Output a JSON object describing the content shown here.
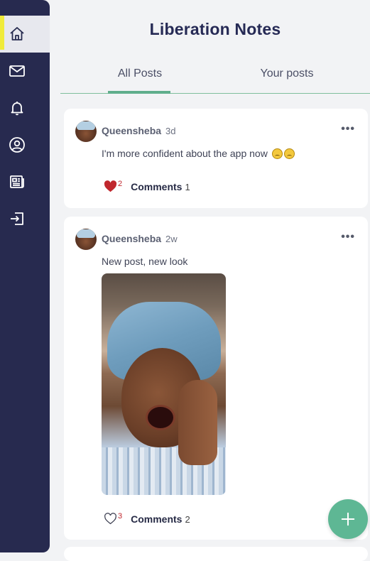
{
  "app": {
    "title": "Liberation Notes"
  },
  "sidebar": {
    "items": [
      {
        "icon": "home-icon",
        "active": true
      },
      {
        "icon": "mail-icon"
      },
      {
        "icon": "bell-icon"
      },
      {
        "icon": "profile-icon"
      },
      {
        "icon": "news-icon"
      },
      {
        "icon": "logout-icon"
      }
    ]
  },
  "tabs": [
    {
      "label": "All Posts",
      "active": true
    },
    {
      "label": "Your posts"
    }
  ],
  "posts": [
    {
      "author": "Queensheba",
      "time": "3d",
      "text": "I'm more confident about the app now",
      "likes": "2",
      "liked": true,
      "comments_label": "Comments",
      "comments": "1"
    },
    {
      "author": "Queensheba",
      "time": "2w",
      "text": "New post, new look",
      "likes": "3",
      "liked": false,
      "comments_label": "Comments",
      "comments": "2"
    }
  ],
  "more_label": "•••",
  "colors": {
    "sidebar": "#272a4f",
    "accent": "#5eb794",
    "active_bar": "#f0eb3a",
    "like": "#c0272d"
  }
}
